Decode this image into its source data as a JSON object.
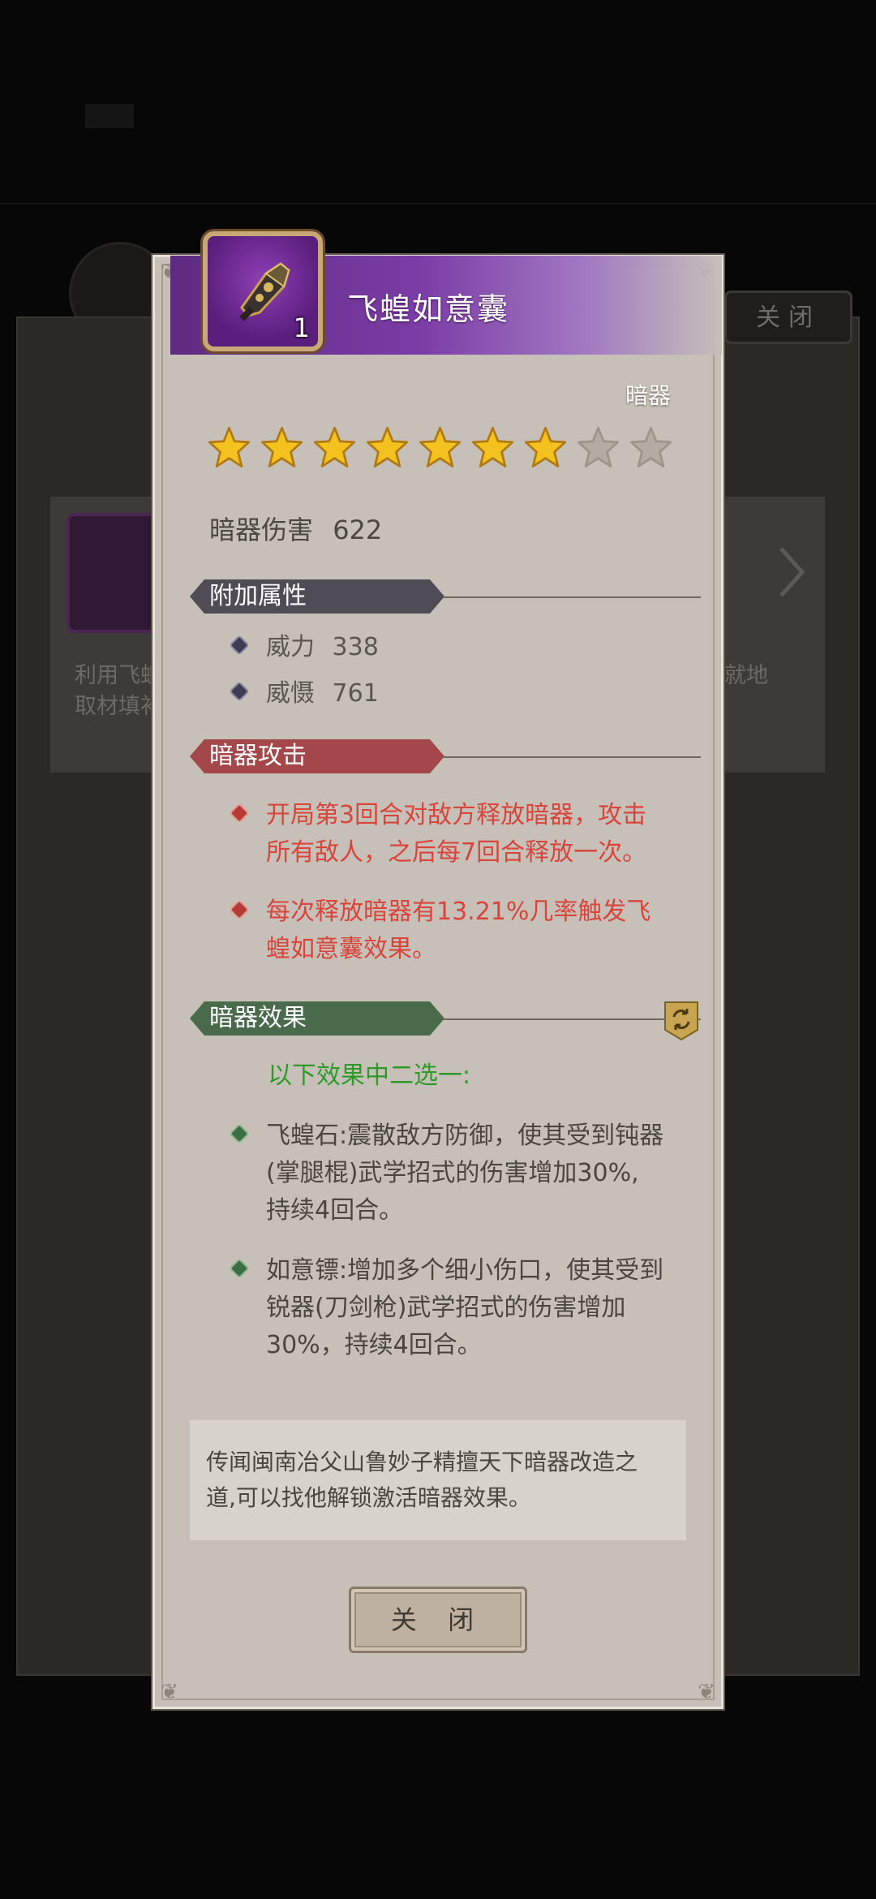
{
  "background": {
    "close_label": "关闭",
    "card_text_left": "利用飞蝗\n取材填补",
    "card_text_right": "就地"
  },
  "modal": {
    "item": {
      "name": "飞蝗如意囊",
      "count": "1",
      "type": "暗器",
      "rarity_color": "#7b3ca6",
      "stars_total": 9,
      "stars_filled": 7,
      "damage_label": "暗器伤害",
      "damage_value": "622"
    },
    "attributes": {
      "header": "附加属性",
      "header_color": "#4f4c55",
      "rows": [
        {
          "label": "威力",
          "value": "338"
        },
        {
          "label": "威慑",
          "value": "761"
        }
      ]
    },
    "attack": {
      "header": "暗器攻击",
      "header_color": "#a4474a",
      "rows": [
        {
          "line1": "开局第3回合对敌方释放暗器，攻击",
          "line2": "所有敌人，之后每7回合释放一次。"
        },
        {
          "line1": "每次释放暗器有13.21%几率触发飞",
          "line2": "蝗如意囊效果。"
        }
      ]
    },
    "effect": {
      "header": "暗器效果",
      "header_color": "#4a6a4c",
      "choose_text": "以下效果中二选一:",
      "options": [
        {
          "line1": "飞蝗石:震散敌方防御，使其受到钝器",
          "line2": "(掌腿棍)武学招式的伤害增加30%,",
          "line3": "持续4回合。"
        },
        {
          "line1": "如意镖:增加多个细小伤口，使其受到",
          "line2": "锐器(刀剑枪)武学招式的伤害增加",
          "line3": "30%，持续4回合。"
        }
      ]
    },
    "info": {
      "line1": "传闻闽南冶父山鲁妙子精擅天下暗器改造之",
      "line2": "道,可以找他解锁激活暗器效果。"
    },
    "close_label": "关 闭"
  }
}
